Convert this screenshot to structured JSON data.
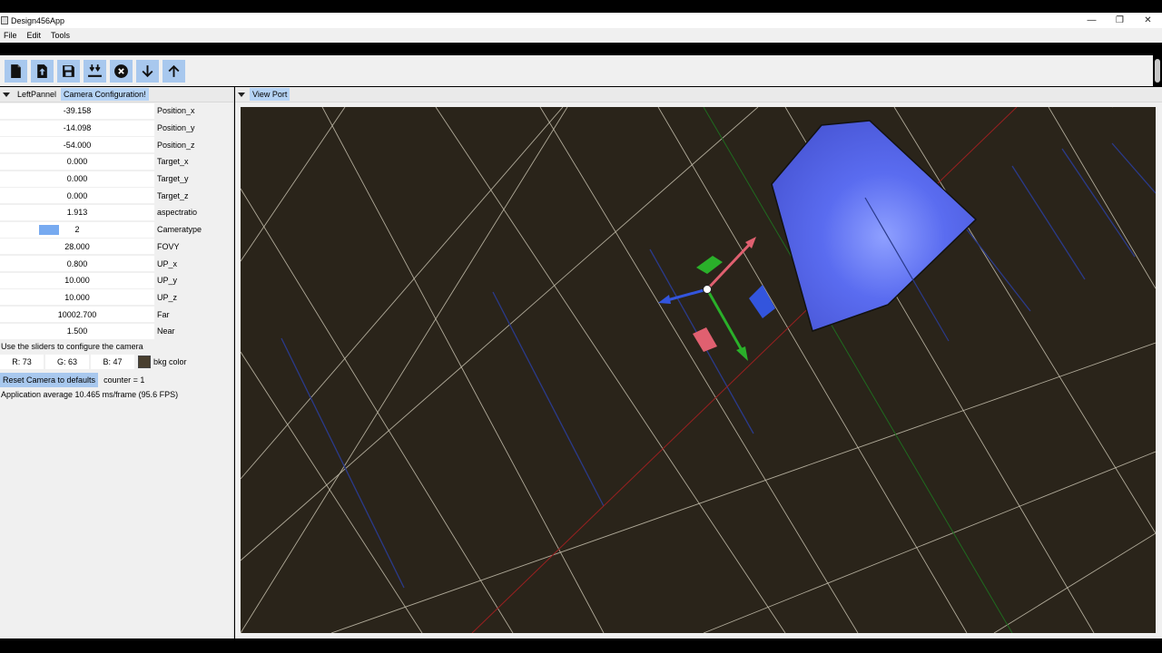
{
  "window": {
    "title": "Design456App",
    "minimize": "—",
    "maximize": "❐",
    "close": "✕"
  },
  "menu": [
    "File",
    "Edit",
    "Tools"
  ],
  "toolbar": {
    "buttons": [
      {
        "name": "new-file-icon"
      },
      {
        "name": "open-file-icon"
      },
      {
        "name": "save-icon"
      },
      {
        "name": "save-all-icon"
      },
      {
        "name": "close-circle-icon"
      },
      {
        "name": "arrow-down-icon"
      },
      {
        "name": "arrow-up-icon"
      }
    ]
  },
  "left_panel": {
    "tabs": [
      "LeftPannel",
      "Camera Configuration!"
    ],
    "fields": [
      {
        "value": "-39.158",
        "label": "Position_x"
      },
      {
        "value": "-14.098",
        "label": "Position_y"
      },
      {
        "value": "-54.000",
        "label": "Position_z"
      },
      {
        "value": "0.000",
        "label": "Target_x"
      },
      {
        "value": "0.000",
        "label": "Target_y"
      },
      {
        "value": "0.000",
        "label": "Target_z"
      },
      {
        "value": "1.913",
        "label": "aspectratio"
      },
      {
        "value": "2",
        "label": "Cameratype"
      },
      {
        "value": "28.000",
        "label": "FOVY"
      },
      {
        "value": "0.800",
        "label": "UP_x"
      },
      {
        "value": "10.000",
        "label": "UP_y"
      },
      {
        "value": "10.000",
        "label": "UP_z"
      },
      {
        "value": "10002.700",
        "label": "Far"
      },
      {
        "value": "1.500",
        "label": "Near"
      }
    ],
    "hint": "Use the sliders to configure the camera",
    "bkg": {
      "r": "R: 73",
      "g": "G: 63",
      "b": "B: 47",
      "label": "bkg color",
      "swatch": "#493f2f"
    },
    "reset_label": "Reset Camera to defaults",
    "counter": "counter = 1",
    "fps": "Application average 10.465 ms/frame (95.6 FPS)"
  },
  "viewport": {
    "tab": "View Port",
    "background": "#2a241a",
    "colors": {
      "grid": "#c8c2b0",
      "x_axis": "#9a2020",
      "y_axis": "#1f6b1f",
      "z_lines": "#2a3a8a",
      "shape": "#5566e8",
      "gizmo_red": "#e06070",
      "gizmo_green": "#2ab02a",
      "gizmo_blue": "#3355dd"
    }
  }
}
